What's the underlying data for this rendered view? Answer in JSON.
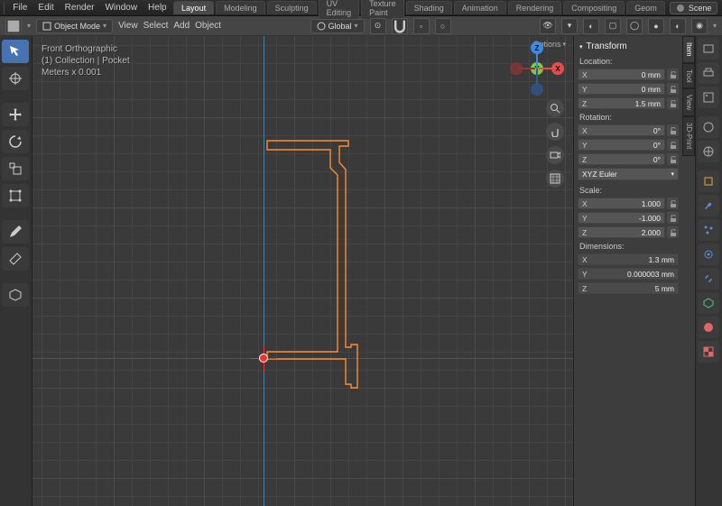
{
  "menu": {
    "items": [
      "File",
      "Edit",
      "Render",
      "Window",
      "Help"
    ]
  },
  "workspace_tabs": [
    "Layout",
    "Modeling",
    "Sculpting",
    "UV Editing",
    "Texture Paint",
    "Shading",
    "Animation",
    "Rendering",
    "Compositing",
    "Geom"
  ],
  "workspace_active": "Layout",
  "scene": {
    "label": "Scene"
  },
  "toolbar": {
    "mode": "Object Mode",
    "view": "View",
    "select": "Select",
    "add": "Add",
    "object": "Object",
    "orientation": "Global",
    "options": "Options"
  },
  "view_info": {
    "line1": "Front Orthographic",
    "line2": "(1) Collection | Pocket",
    "line3": "Meters x 0.001"
  },
  "gizmo_axes": {
    "x": "X",
    "y": "Y",
    "z": "Z"
  },
  "transform": {
    "title": "Transform",
    "location_label": "Location:",
    "location": {
      "x_lab": "X",
      "x_val": "0 mm",
      "y_lab": "Y",
      "y_val": "0 mm",
      "z_lab": "Z",
      "z_val": "1.5 mm"
    },
    "rotation_label": "Rotation:",
    "rotation": {
      "x_lab": "X",
      "x_val": "0°",
      "y_lab": "Y",
      "y_val": "0°",
      "z_lab": "Z",
      "z_val": "0°"
    },
    "rotation_mode": "XYZ Euler",
    "scale_label": "Scale:",
    "scale": {
      "x_lab": "X",
      "x_val": "1.000",
      "y_lab": "Y",
      "y_val": "-1.000",
      "z_lab": "Z",
      "z_val": "2.000"
    },
    "dimensions_label": "Dimensions:",
    "dimensions": {
      "x_lab": "X",
      "x_val": "1.3 mm",
      "y_lab": "Y",
      "y_val": "0.000003 mm",
      "z_lab": "Z",
      "z_val": "5 mm"
    }
  },
  "n_tabs": [
    "Item",
    "Tool",
    "View",
    "3D-Print"
  ]
}
